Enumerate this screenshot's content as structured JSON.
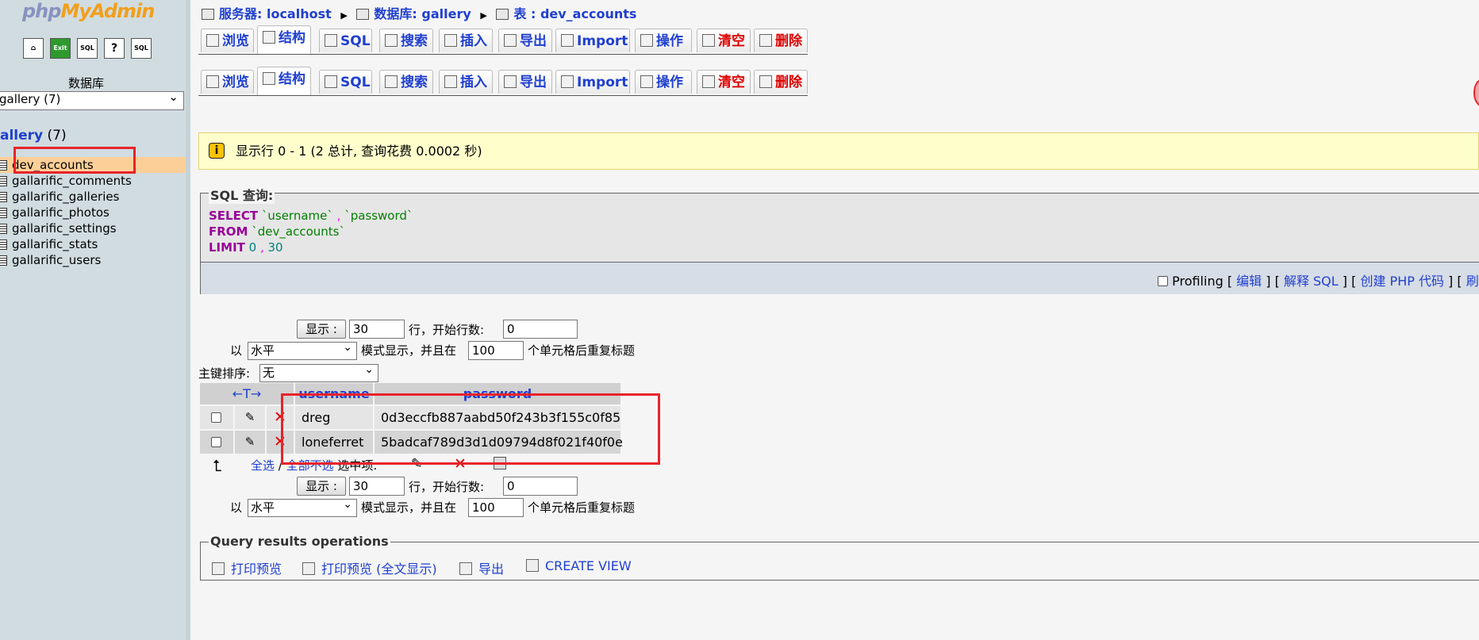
{
  "logo": {
    "php": "php",
    "myadmin": "MyAdmin"
  },
  "left_icons": [
    {
      "name": "home-icon",
      "glyph": "⌂"
    },
    {
      "name": "exit-icon",
      "glyph": "Exit"
    },
    {
      "name": "sql-window-icon",
      "glyph": "SQL"
    },
    {
      "name": "docs-icon",
      "glyph": "?"
    },
    {
      "name": "sql-docs-icon",
      "glyph": "SQL"
    }
  ],
  "sidebar": {
    "db_label": "数据库",
    "db_select": "gallery (7)",
    "db_title_name": "allery",
    "db_title_count": " (7)",
    "tables": [
      "dev_accounts",
      "gallarific_comments",
      "gallarific_galleries",
      "gallarific_photos",
      "gallarific_settings",
      "gallarific_stats",
      "gallarific_users"
    ]
  },
  "breadcrumb": {
    "server": "服务器: localhost",
    "database": "数据库: gallery",
    "table": "表 : dev_accounts"
  },
  "tabs": [
    {
      "label": "浏览"
    },
    {
      "label": "结构"
    },
    {
      "label": "SQL"
    },
    {
      "label": "搜索"
    },
    {
      "label": "插入"
    },
    {
      "label": "导出"
    },
    {
      "label": "Import"
    },
    {
      "label": "操作"
    },
    {
      "label": "清空"
    },
    {
      "label": "删除"
    }
  ],
  "notice": "显示行 0 - 1 (2 总计, 查询花费 0.0002 秒)",
  "sql": {
    "legend": "SQL 查询:",
    "select_kw": "SELECT",
    "col1": " `username`",
    "comma": " ,",
    "col2": " `password`",
    "from_kw": "FROM",
    "table": " `dev_accounts`",
    "limit_kw": "LIMIT",
    "limit_a": " 0",
    "limit_b": " 30",
    "profiling": "Profiling",
    "edit": "编辑",
    "explain": "解释 SQL",
    "php_code": "创建 PHP 代码",
    "refresh": "刷新"
  },
  "nav": {
    "show_btn": "显示 :",
    "rows": "30",
    "rows_label": "行，开始行数:",
    "start": "0",
    "mode_prefix": "以",
    "mode": "水平",
    "mode_suffix": "模式显示，并且在",
    "repeat": "100",
    "repeat_suffix": "个单元格后重复标题",
    "sort_label": "主键排序:",
    "sort_value": "无"
  },
  "results": {
    "arrows": "←T→",
    "headers": [
      "username",
      "password"
    ],
    "rows": [
      {
        "username": "dreg",
        "password": "0d3eccfb887aabd50f243b3f155c0f85"
      },
      {
        "username": "loneferret",
        "password": "5badcaf789d3d1d09794d8f021f40f0e"
      }
    ],
    "check_all": "全选",
    "slash": " / ",
    "uncheck_all": "全部不选",
    "with_selected": "选中项:"
  },
  "query_ops": {
    "legend": "Query results operations",
    "print": "打印预览",
    "print_full": "打印预览 (全文显示)",
    "export": "导出",
    "create_view": "CREATE VIEW"
  },
  "annotation_color": "#e8232b"
}
